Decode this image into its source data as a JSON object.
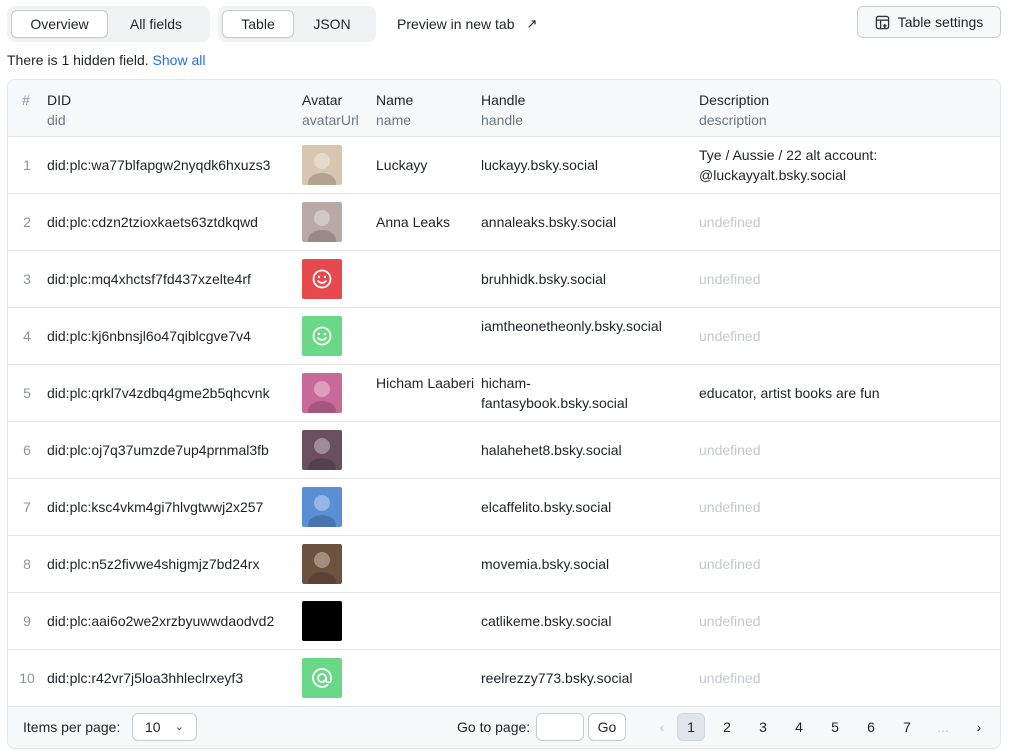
{
  "toolbar": {
    "view_tabs": [
      "Overview",
      "All fields"
    ],
    "format_tabs": [
      "Table",
      "JSON"
    ],
    "preview_label": "Preview in new tab",
    "preview_icon": "arrow-up-right-icon",
    "settings_label": "Table settings",
    "settings_icon": "table-settings-icon"
  },
  "notice": {
    "text": "There is 1 hidden field.",
    "link": "Show all"
  },
  "table": {
    "columns": [
      {
        "label": "#",
        "key": ""
      },
      {
        "label": "DID",
        "key": "did"
      },
      {
        "label": "Avatar",
        "key": "avatarUrl"
      },
      {
        "label": "Name",
        "key": "name"
      },
      {
        "label": "Handle",
        "key": "handle"
      },
      {
        "label": "Description",
        "key": "description"
      }
    ],
    "rows": [
      {
        "idx": "1",
        "did": "did:plc:wa77blfapgw2nyqdk6hxuzs3",
        "name": "Luckayy",
        "handle": "luckayy.bsky.social",
        "description": "Tye / Aussie / 22 alt account: @luckayyalt.bsky.social",
        "avatar_color": "#d8c7b0",
        "avatar_kind": "photo"
      },
      {
        "idx": "2",
        "did": "did:plc:cdzn2tzioxkaets63ztdkqwd",
        "name": "Anna Leaks",
        "handle": "annaleaks.bsky.social",
        "description": "undefined",
        "avatar_color": "#b9a9a6",
        "avatar_kind": "photo"
      },
      {
        "idx": "3",
        "did": "did:plc:mq4xhctsf7fd437xzelte4rf",
        "name": "",
        "handle": "bruhhidk.bsky.social",
        "description": "undefined",
        "avatar_color": "#e5484d",
        "avatar_kind": "smiley"
      },
      {
        "idx": "4",
        "did": "did:plc:kj6nbnsjl6o47qiblcgve7v4",
        "name": "",
        "handle": "iamtheonetheonly.bsky.social",
        "description": "undefined",
        "avatar_color": "#6ad987",
        "avatar_kind": "smiley"
      },
      {
        "idx": "5",
        "did": "did:plc:qrkl7v4zdbq4gme2b5qhcvnk",
        "name": "Hicham Laaberi",
        "handle": "hicham-fantasybook.bsky.social",
        "description": "educator, artist books are fun",
        "avatar_color": "#c86a9a",
        "avatar_kind": "photo"
      },
      {
        "idx": "6",
        "did": "did:plc:oj7q37umzde7up4prnmal3fb",
        "name": "",
        "handle": "halahehet8.bsky.social",
        "description": "undefined",
        "avatar_color": "#6b4f5f",
        "avatar_kind": "photo"
      },
      {
        "idx": "7",
        "did": "did:plc:ksc4vkm4gi7hlvgtwwj2x257",
        "name": "",
        "handle": "elcaffelito.bsky.social",
        "description": "undefined",
        "avatar_color": "#5a8fd6",
        "avatar_kind": "photo"
      },
      {
        "idx": "8",
        "did": "did:plc:n5z2fivwe4shigmjz7bd24rx",
        "name": "",
        "handle": "movemia.bsky.social",
        "description": "undefined",
        "avatar_color": "#6e5240",
        "avatar_kind": "photo"
      },
      {
        "idx": "9",
        "did": "did:plc:aai6o2we2xrzbyuwwdaodvd2",
        "name": "",
        "handle": "catlikeme.bsky.social",
        "description": "undefined",
        "avatar_color": "#000000",
        "avatar_kind": "photo"
      },
      {
        "idx": "10",
        "did": "did:plc:r42vr7j5loa3hhleclrxeyf3",
        "name": "",
        "handle": "reelrezzy773.bsky.social",
        "description": "undefined",
        "avatar_color": "#6ad987",
        "avatar_kind": "at"
      }
    ]
  },
  "footer": {
    "items_per_page_label": "Items per page:",
    "items_per_page_value": "10",
    "goto_label": "Go to page:",
    "go_label": "Go",
    "pages": [
      "1",
      "2",
      "3",
      "4",
      "5",
      "6",
      "7",
      "..."
    ],
    "current_page": "1",
    "prev_glyph": "‹",
    "next_glyph": "›"
  }
}
